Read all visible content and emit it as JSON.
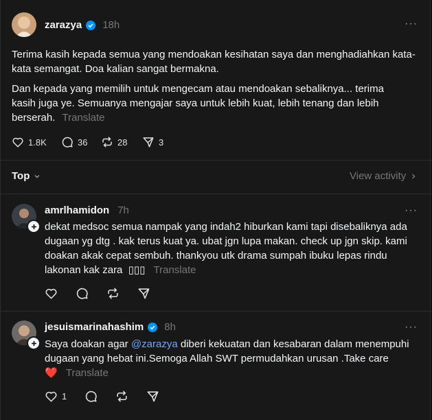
{
  "post": {
    "username": "zarazya",
    "time": "18h",
    "paragraph1": "Terima kasih kepada semua yang mendoakan kesihatan saya dan menghadiahkan kata-kata semangat. Doa kalian sangat bermakna.",
    "paragraph2": "Dan kepada yang memilih untuk mengecam atau mendoakan sebaliknya... terima kasih juga ye. Semuanya mengajar saya untuk lebih kuat, lebih tenang dan lebih berserah.",
    "translate": "Translate",
    "likes": "1.8K",
    "comments": "36",
    "reposts": "28",
    "shares": "3",
    "more": "···"
  },
  "sort": {
    "label": "Top",
    "view_activity": "View activity"
  },
  "replies": [
    {
      "username": "amrlhamidon",
      "time": "7h",
      "text": "dekat medsoc semua nampak yang indah2 hiburkan kami tapi disebaliknya ada dugaan yg dtg . kak terus kuat ya. ubat jgn lupa makan. check up jgn skip. kami doakan akak cepat sembuh. thankyou utk drama sumpah ibuku lepas rindu lakonan kak zara",
      "emoji": "▯▯▯",
      "translate": "Translate",
      "more": "···"
    },
    {
      "username": "jesuismarinahashim",
      "time": "8h",
      "text_before": "Saya doakan agar ",
      "mention": "@zarazya",
      "text_after": " diberi kekuatan dan kesabaran dalam menempuhi dugaan yang hebat ini.Semoga Allah SWT permudahkan urusan .Take care",
      "emoji": "❤️",
      "translate": "Translate",
      "likes": "1",
      "more": "···"
    }
  ],
  "colors": {
    "background": "#181818",
    "text": "#f3f5f7",
    "muted": "#777777",
    "verified": "#0095f6",
    "mention": "#6aa8ff",
    "divider": "#2d2d2d"
  }
}
